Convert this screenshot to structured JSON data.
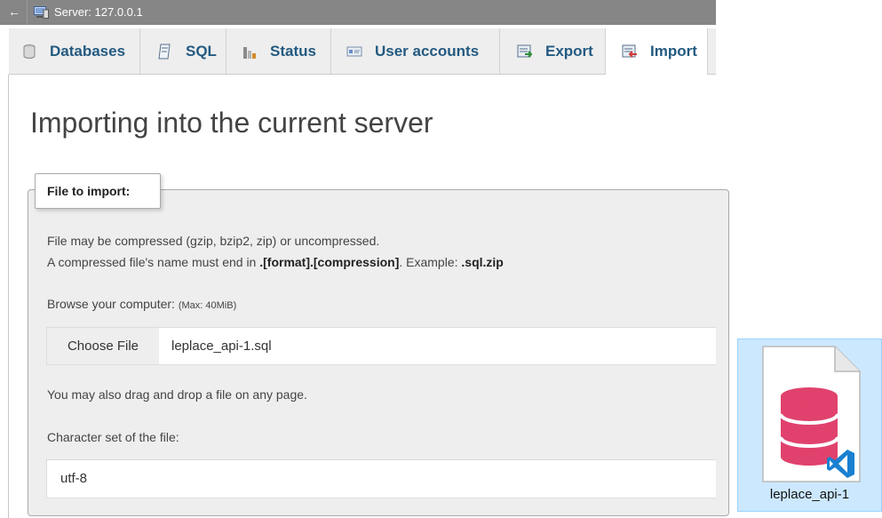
{
  "topbar": {
    "back_arrow": "←",
    "server_label": "Server: 127.0.0.1"
  },
  "tabs": [
    {
      "label": "Databases",
      "icon": "database-icon"
    },
    {
      "label": "SQL",
      "icon": "sql-icon"
    },
    {
      "label": "Status",
      "icon": "status-chart-icon"
    },
    {
      "label": "User accounts",
      "icon": "user-accounts-icon"
    },
    {
      "label": "Export",
      "icon": "export-icon"
    },
    {
      "label": "Import",
      "icon": "import-icon",
      "active": true
    }
  ],
  "main": {
    "title": "Importing into the current server",
    "fieldset": {
      "legend": "File to import:",
      "compress_line1": "File may be compressed (gzip, bzip2, zip) or uncompressed.",
      "compress_line2_pre": "A compressed file's name must end in ",
      "compress_line2_format": ".[format].[compression]",
      "compress_line2_mid": ". Example: ",
      "compress_line2_example": ".sql.zip",
      "browse_label": "Browse your computer: ",
      "browse_max": "(Max: 40MiB)",
      "choose_button": "Choose File",
      "chosen_file": "leplace_api-1.sql",
      "drag_drop_hint": "You may also drag and drop a file on any page.",
      "charset_label": "Character set of the file:",
      "charset_value": "utf-8"
    }
  },
  "desktop_file": {
    "label": "leplace_api-1",
    "icon": "database-file-icon",
    "overlay_icon": "vscode-icon"
  },
  "colors": {
    "topbar": "#868686",
    "tab_text": "#235a81",
    "fieldset_bg": "#eeeeee",
    "selection_bg": "#cce8ff",
    "database_icon": "#e0426d",
    "vscode_blue": "#1a80d1"
  }
}
